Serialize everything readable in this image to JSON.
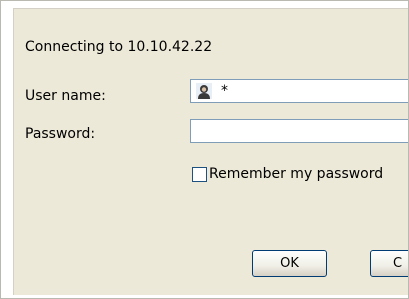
{
  "dialog": {
    "title": "Connecting to 10.10.42.22",
    "user_label": "User name:",
    "user_value": "*",
    "user_icon": "user-account-icon",
    "password_label": "Password:",
    "password_value": "",
    "remember_label": "Remember my password",
    "remember_checked": false,
    "ok_label": "OK",
    "cancel_label": "C"
  },
  "colors": {
    "dialog_bg": "#ece9d8",
    "field_border": "#7f9db9",
    "checkbox_border": "#1c5180",
    "button_border": "#003c74"
  }
}
